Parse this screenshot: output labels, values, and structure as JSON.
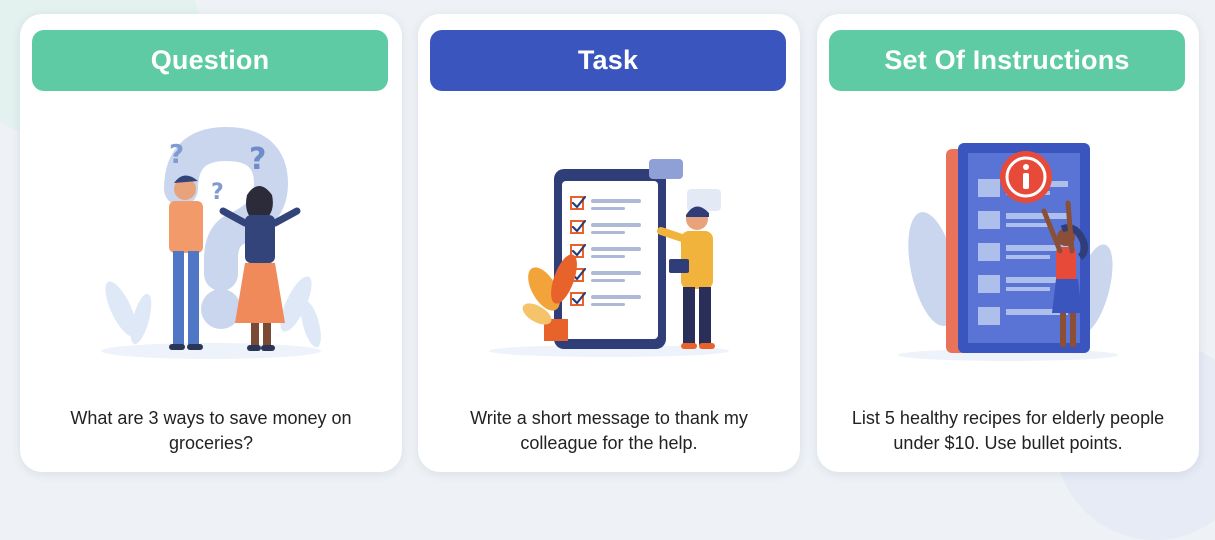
{
  "cards": [
    {
      "title": "Question",
      "text": "What are 3 ways to save money on groceries?",
      "illustration": "people-wondering-question-marks",
      "header_color": "#5ecba5"
    },
    {
      "title": "Task",
      "text": "Write a short message to thank my colleague for the help.",
      "illustration": "man-checklist-tablet",
      "header_color": "#3a55bd"
    },
    {
      "title": "Set Of Instructions",
      "text": "List 5 healthy recipes for elderly people under $10. Use bullet points.",
      "illustration": "woman-info-document",
      "header_color": "#5ecba5"
    }
  ]
}
